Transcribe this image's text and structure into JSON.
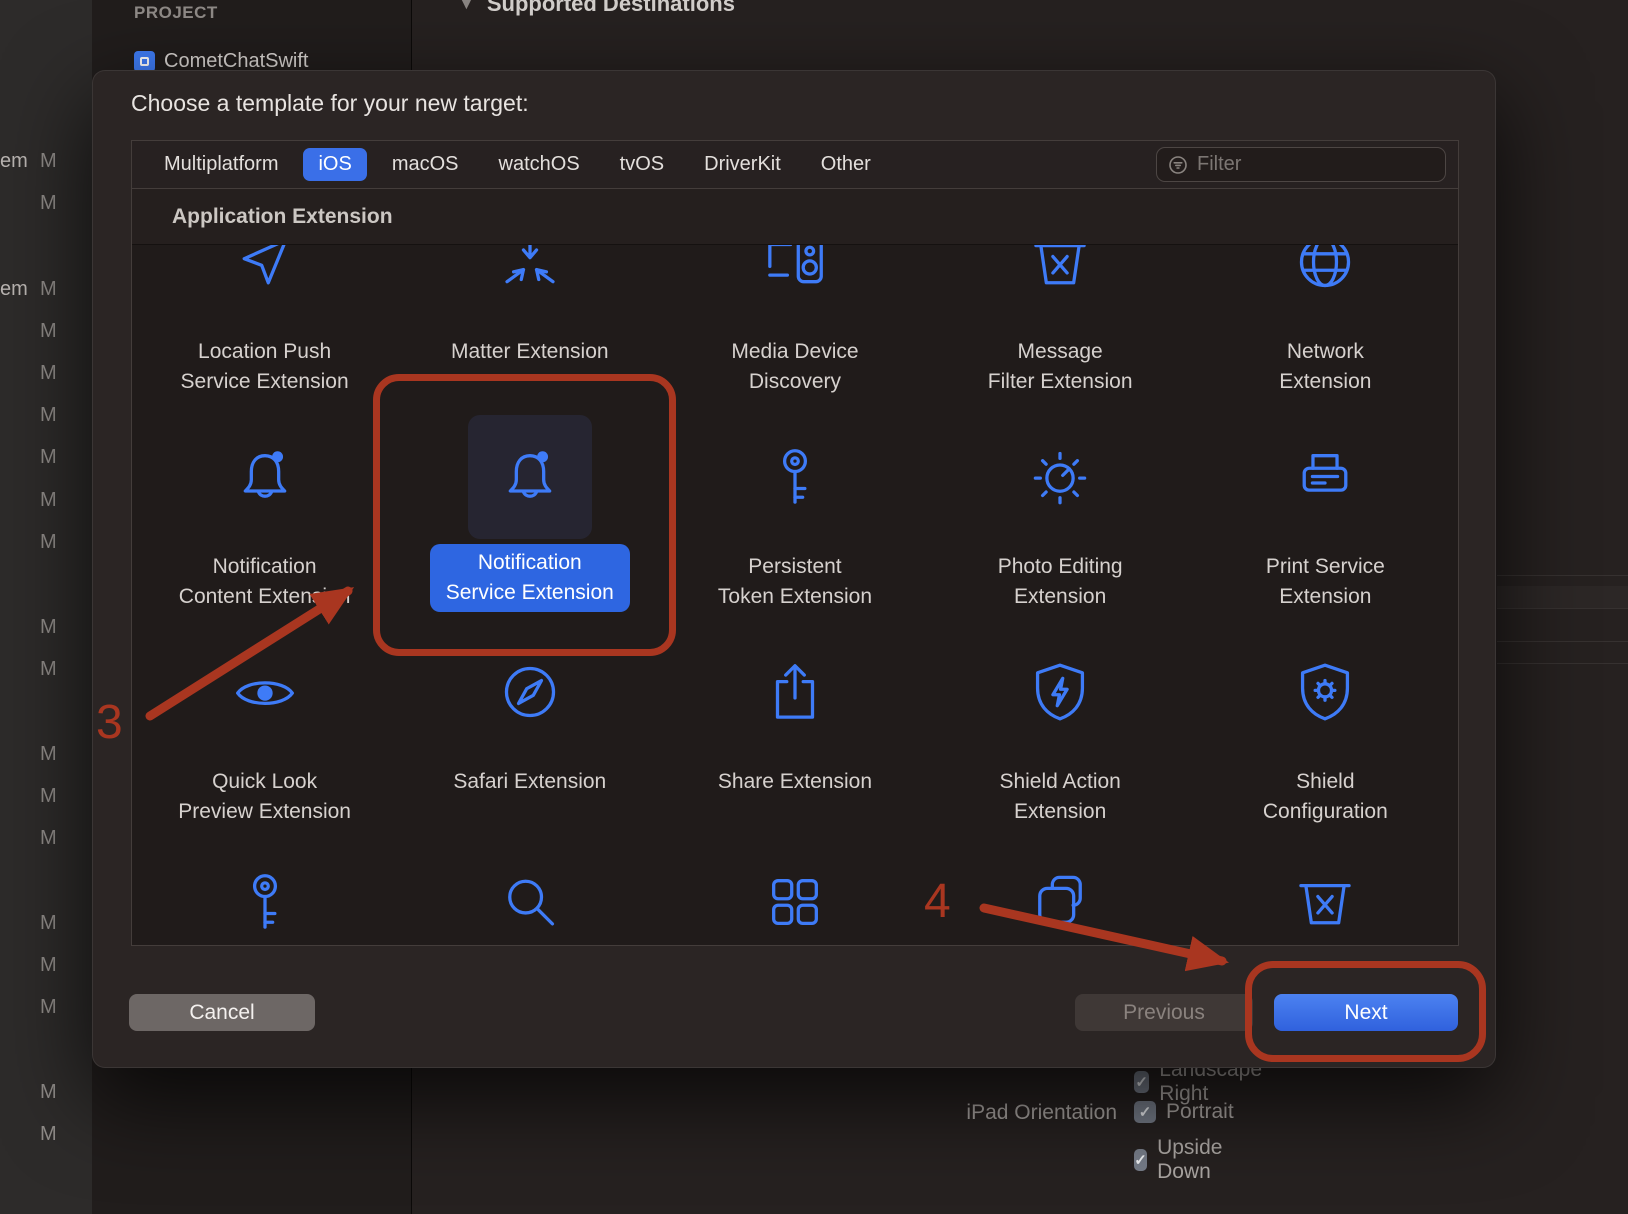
{
  "theme": {
    "icon_blue": "#3E7BF7",
    "accent_blue": "#3A6FE8",
    "annotation_red": "#A93620"
  },
  "background": {
    "project_section_label": "PROJECT",
    "project_name": "CometChatSwift",
    "destinations_header": "Supported Destinations",
    "gutter_rows": [
      {
        "prefix": "em",
        "mark": "M"
      },
      {
        "prefix": "",
        "mark": "M"
      },
      {
        "prefix": "em",
        "mark": "M"
      },
      {
        "prefix": "",
        "mark": "M"
      },
      {
        "prefix": "",
        "mark": "M"
      },
      {
        "prefix": "",
        "mark": "M"
      },
      {
        "prefix": "",
        "mark": "M"
      },
      {
        "prefix": "",
        "mark": "M"
      },
      {
        "prefix": "",
        "mark": "M"
      },
      {
        "prefix": "",
        "mark": "M"
      },
      {
        "prefix": "",
        "mark": "M"
      },
      {
        "prefix": "",
        "mark": "M"
      },
      {
        "prefix": "",
        "mark": "M"
      },
      {
        "prefix": "",
        "mark": "M"
      },
      {
        "prefix": "",
        "mark": "M"
      },
      {
        "prefix": "",
        "mark": "M"
      },
      {
        "prefix": "",
        "mark": "M"
      },
      {
        "prefix": "",
        "mark": "M"
      },
      {
        "prefix": "",
        "mark": "M"
      }
    ],
    "ipad_orientation": {
      "label": "iPad Orientation",
      "options": [
        {
          "label": "Landscape Right",
          "checked": true
        },
        {
          "label": "Portrait",
          "checked": true
        },
        {
          "label": "Upside Down",
          "checked": true
        }
      ],
      "check_glyph": "✓"
    }
  },
  "dialog": {
    "title": "Choose a template for your new target:",
    "tabs": [
      {
        "label": "Multiplatform",
        "selected": false
      },
      {
        "label": "iOS",
        "selected": true
      },
      {
        "label": "macOS",
        "selected": false
      },
      {
        "label": "watchOS",
        "selected": false
      },
      {
        "label": "tvOS",
        "selected": false
      },
      {
        "label": "DriverKit",
        "selected": false
      },
      {
        "label": "Other",
        "selected": false
      }
    ],
    "filter": {
      "placeholder": "Filter"
    },
    "section_header": "Application Extension",
    "templates": {
      "rows": [
        [
          {
            "icon": "location-arrow-icon",
            "lines": [
              "Location Push",
              "Service Extension"
            ],
            "selected": false
          },
          {
            "icon": "matter-icon",
            "lines": [
              "Matter Extension"
            ],
            "selected": false
          },
          {
            "icon": "media-device-icon",
            "lines": [
              "Media Device",
              "Discovery"
            ],
            "selected": false
          },
          {
            "icon": "message-filter-basket-icon",
            "lines": [
              "Message",
              "Filter Extension"
            ],
            "selected": false
          },
          {
            "icon": "network-globe-icon",
            "lines": [
              "Network",
              "Extension"
            ],
            "selected": false
          }
        ],
        [
          {
            "icon": "notification-bell-icon",
            "lines": [
              "Notification",
              "Content Extension"
            ],
            "selected": false
          },
          {
            "icon": "notification-bell-icon",
            "lines": [
              "Notification",
              "Service Extension"
            ],
            "selected": true
          },
          {
            "icon": "key-icon",
            "lines": [
              "Persistent",
              "Token Extension"
            ],
            "selected": false
          },
          {
            "icon": "photo-dial-icon",
            "lines": [
              "Photo Editing",
              "Extension"
            ],
            "selected": false
          },
          {
            "icon": "printer-icon",
            "lines": [
              "Print Service",
              "Extension"
            ],
            "selected": false
          }
        ],
        [
          {
            "icon": "eye-icon",
            "lines": [
              "Quick Look",
              "Preview Extension"
            ],
            "selected": false
          },
          {
            "icon": "safari-compass-icon",
            "lines": [
              "Safari Extension"
            ],
            "selected": false
          },
          {
            "icon": "share-icon",
            "lines": [
              "Share Extension"
            ],
            "selected": false
          },
          {
            "icon": "shield-bolt-icon",
            "lines": [
              "Shield Action",
              "Extension"
            ],
            "selected": false
          },
          {
            "icon": "shield-gear-icon",
            "lines": [
              "Shield",
              "Configuration"
            ],
            "selected": false
          }
        ],
        [
          {
            "icon": "key-icon",
            "lines": [],
            "selected": false
          },
          {
            "icon": "search-icon",
            "lines": [],
            "selected": false
          },
          {
            "icon": "app-grid-icon",
            "lines": [],
            "selected": false
          },
          {
            "icon": "sticker-icon",
            "lines": [],
            "selected": false
          },
          {
            "icon": "basket-x-icon",
            "lines": [],
            "selected": false
          }
        ]
      ]
    },
    "footer": {
      "cancel": "Cancel",
      "previous": "Previous",
      "next": "Next"
    }
  },
  "annotations": {
    "step_three": "3",
    "step_four": "4"
  }
}
